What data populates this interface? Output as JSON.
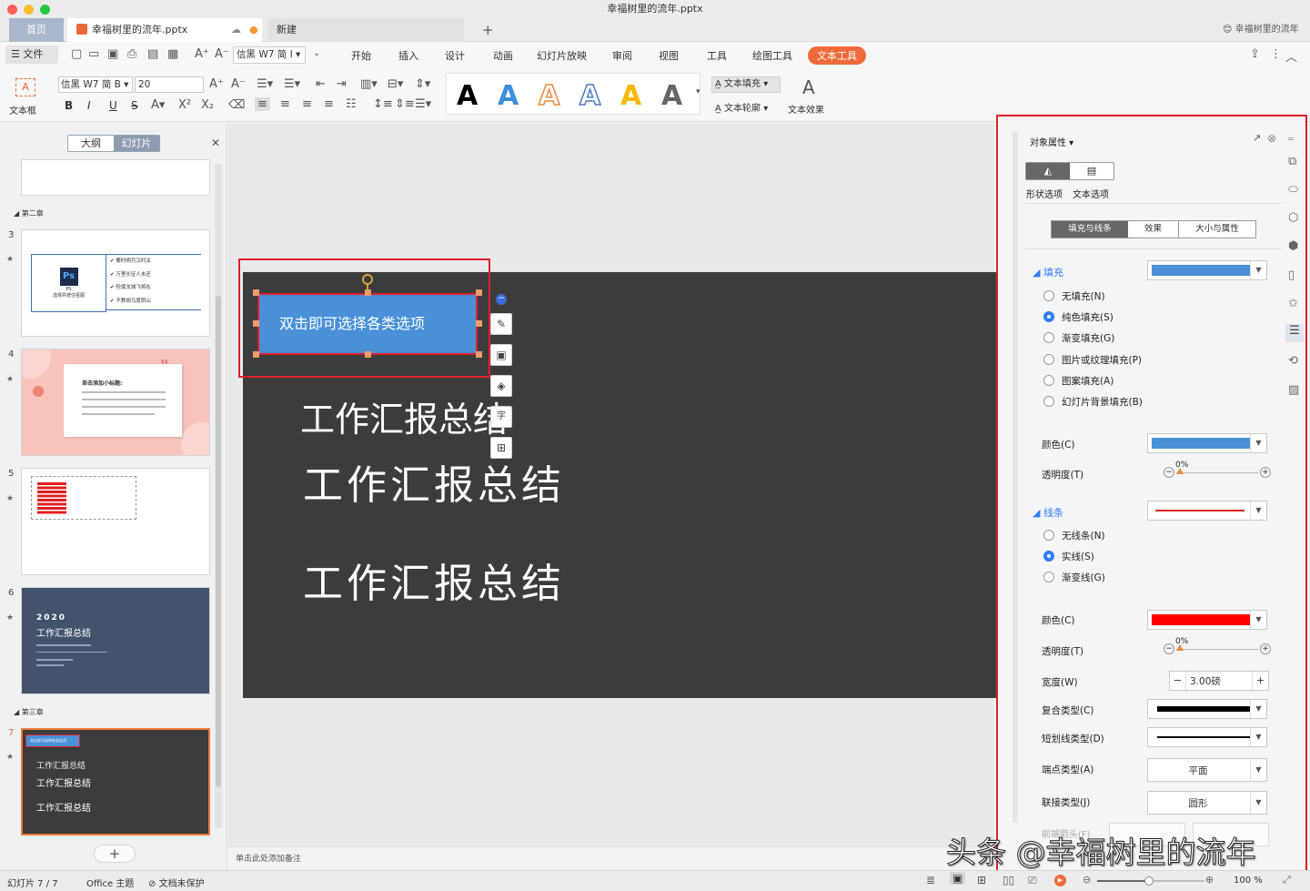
{
  "window": {
    "title": "幸福树里的流年.pptx",
    "user": "幸福树里的流年"
  },
  "tabs": [
    {
      "label": "首页"
    },
    {
      "label": "幸福树里的流年.pptx"
    },
    {
      "label": "新建"
    }
  ],
  "menu": {
    "file": "文件",
    "items": [
      "开始",
      "插入",
      "设计",
      "动画",
      "幻灯片放映",
      "审阅",
      "视图",
      "工具",
      "绘图工具",
      "文本工具"
    ],
    "active": "文本工具"
  },
  "toolbar": {
    "textbox": "文本框",
    "font1": "信黑 W7 简 I",
    "font2": "信黑 W7 简 B",
    "size": "20",
    "text_fill": "文本填充",
    "text_outline": "文本轮廓",
    "text_effect": "文本效果",
    "bold": "B",
    "italic": "I",
    "underline": "U",
    "strike": "S"
  },
  "left_panel": {
    "tab_outline": "大纲",
    "tab_slides": "幻灯片",
    "section2": "第二章",
    "section3": "第三章",
    "slides": [
      {
        "num": "3",
        "items": [
          "要时明月汉时关",
          "万里长征人未还",
          "但使龙城飞将在",
          "不教胡马度阴山"
        ],
        "ps_caption": "选择并遮住抠图",
        "ps_label": "PS"
      },
      {
        "num": "4",
        "title": "单击添加小标题:"
      },
      {
        "num": "5"
      },
      {
        "num": "6",
        "year": "2020",
        "title": "工作汇报总结"
      },
      {
        "num": "7",
        "box": "双击即可选择各类选项",
        "l1": "工作汇报总结",
        "l2": "工作汇报总结",
        "l3": "工作汇报总结"
      }
    ]
  },
  "slide": {
    "button_text": "双击即可选择各类选项",
    "text1": "工作汇报总结",
    "text2": "工作汇报总结",
    "text3": "工作汇报总结",
    "notes": "单击此处添加备注"
  },
  "props": {
    "title": "对象属性",
    "tab_shape": "形状选项",
    "tab_text": "文本选项",
    "sub_fill": "填充与线条",
    "sub_effect": "效果",
    "sub_size": "大小与属性",
    "fill_section": "填充",
    "fill_options": [
      "无填充(N)",
      "纯色填充(S)",
      "渐变填充(G)",
      "图片或纹理填充(P)",
      "图案填充(A)",
      "幻灯片背景填充(B)"
    ],
    "fill_selected": 1,
    "color_label": "颜色(C)",
    "transparency_label": "透明度(T)",
    "transparency_value": "0%",
    "line_section": "线条",
    "line_options": [
      "无线条(N)",
      "实线(S)",
      "渐变线(G)"
    ],
    "line_selected": 1,
    "line_color_label": "颜色(C)",
    "line_transparency_label": "透明度(T)",
    "line_transparency_value": "0%",
    "width_label": "宽度(W)",
    "width_value": "3.00磅",
    "compound_label": "复合类型(C)",
    "dash_label": "短划线类型(D)",
    "cap_label": "端点类型(A)",
    "cap_value": "平面",
    "join_label": "联接类型(J)",
    "join_value": "圆形",
    "arrow_label": "前端箭头(F)",
    "colors": {
      "fill": "#4a90d9",
      "line": "#ff0000"
    }
  },
  "status": {
    "slide_info": "幻灯片 7 / 7",
    "theme": "Office 主题",
    "protect": "文档未保护",
    "zoom": "100 %"
  },
  "watermark": "头条 @幸福树里的流年"
}
